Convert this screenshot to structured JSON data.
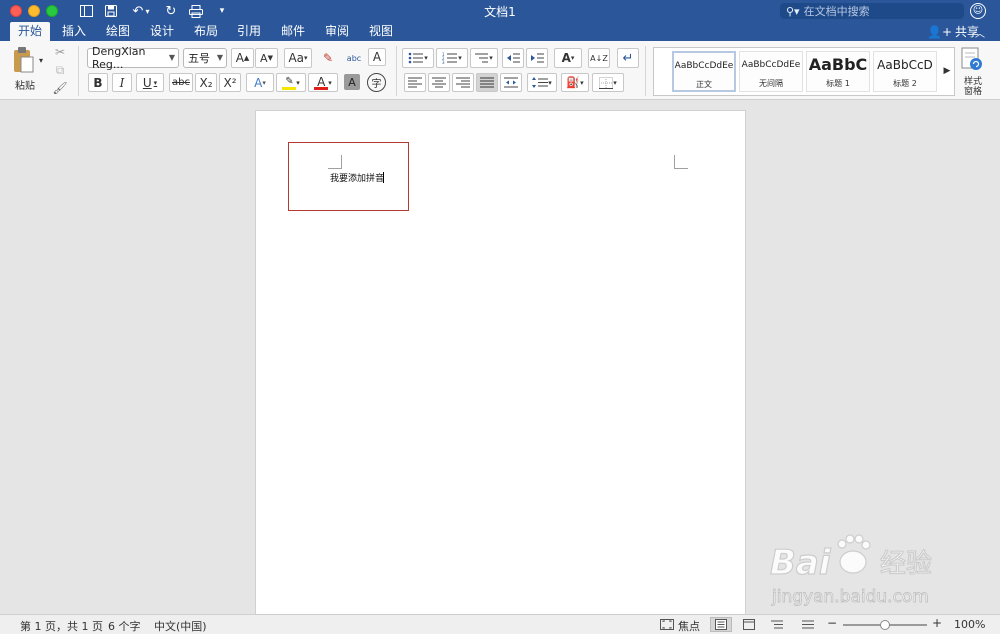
{
  "window": {
    "title": "文档1",
    "search_placeholder": "在文档中搜索"
  },
  "tabs": [
    {
      "label": "开始",
      "active": true
    },
    {
      "label": "插入"
    },
    {
      "label": "绘图"
    },
    {
      "label": "设计"
    },
    {
      "label": "布局"
    },
    {
      "label": "引用"
    },
    {
      "label": "邮件"
    },
    {
      "label": "审阅"
    },
    {
      "label": "视图"
    }
  ],
  "share_label": "共享",
  "ribbon": {
    "paste_label": "粘贴",
    "font_name": "DengXian Reg...",
    "font_size": "五号",
    "grow_font": "A",
    "shrink_font": "A",
    "change_case": "Aa",
    "phonetic_guide": "abc",
    "char_border": "A",
    "bold": "B",
    "italic": "I",
    "underline": "U",
    "strikethrough": "abc",
    "subscript": "X₂",
    "superscript": "X²",
    "text_effects": "A",
    "font_color": "A",
    "char_shading": "A",
    "enclose_char": "字",
    "sort_label": "A↓Z",
    "styles": [
      {
        "sample": "AaBbCcDdEe",
        "name": "正文",
        "selected": true
      },
      {
        "sample": "AaBbCcDdEe",
        "name": "无间隔"
      },
      {
        "sample": "AaBbC",
        "name": "标题 1"
      },
      {
        "sample": "AaBbCcD",
        "name": "标题 2"
      }
    ],
    "styles_pane_label": "样式\n窗格"
  },
  "document": {
    "text": "我要添加拼音"
  },
  "statusbar": {
    "page_info": "第 1 页，共 1 页",
    "word_count": "6 个字",
    "language": "中文(中国)",
    "focus_label": "焦点",
    "zoom_level": "100%",
    "zoom_fraction": 0.5
  },
  "watermark": {
    "brand": "Bai 经验",
    "url": "jingyan.baidu.com"
  },
  "colors": {
    "brand": "#2b579a",
    "highlight_box": "#b23a30",
    "font_color_bar": "#e0211a",
    "highlighter_bar": "#f7e600"
  }
}
